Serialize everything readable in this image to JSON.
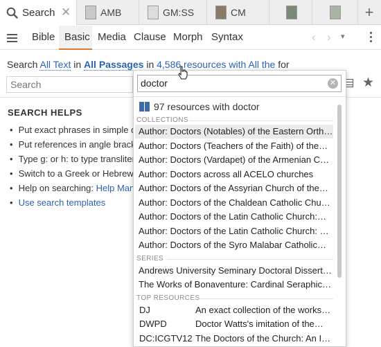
{
  "tabs": [
    {
      "label": "Search",
      "active": true
    },
    {
      "label": "AMB"
    },
    {
      "label": "GM:SS"
    },
    {
      "label": "CM"
    },
    {
      "label": ""
    },
    {
      "label": ""
    }
  ],
  "toolbar": {
    "tabs": [
      "Bible",
      "Basic",
      "Media",
      "Clause",
      "Morph",
      "Syntax"
    ],
    "active_tab": "Basic"
  },
  "sentence": {
    "prefix": "Search",
    "all_text": "All Text",
    "in1": "in",
    "all_passages": "All Passages",
    "in2": "in",
    "resources": "4,586 resources with All the",
    "for": "for"
  },
  "search": {
    "placeholder": "Search"
  },
  "helps": {
    "title": "SEARCH HELPS",
    "items": [
      "Put exact phrases in simple qu",
      "Put references in angle bracket",
      "Type g: or h: to type translitera",
      "Switch to a Greek or Hebrew ke",
      "Help on searching:",
      "Use search templates"
    ],
    "help_link": "Help Manua"
  },
  "dropdown": {
    "query": "doctor",
    "count": "97 resources with doctor",
    "collections_label": "COLLECTIONS",
    "collections": [
      "Author: Doctors (Notables) of the Eastern Orth…",
      "Author: Doctors (Teachers of the Faith) of the…",
      "Author: Doctors (Vardapet) of the Armenian C…",
      "Author: Doctors across all ACELO churches",
      "Author: Doctors of the Assyrian Church of the…",
      "Author: Doctors of the Chaldean Catholic Chur…",
      "Author: Doctors of the Latin Catholic Church:…",
      "Author: Doctors of the Latin Catholic Church: s…",
      "Author: Doctors of the Syro Malabar Catholic…"
    ],
    "series_label": "SERIES",
    "series": [
      "Andrews University Seminary Doctoral Dissert…",
      "The Works of Bonaventure: Cardinal Seraphic…"
    ],
    "top_label": "TOP RESOURCES",
    "top_resources": [
      {
        "abbr": "DJ",
        "title": "An exact collection of the works…"
      },
      {
        "abbr": "DWPD",
        "title": "Doctor Watts's imitation of the…"
      },
      {
        "abbr": "DC:ICGTV12",
        "title": "The Doctors of the Church: An I…"
      }
    ]
  },
  "colors": {
    "accent": "#e07a2e",
    "link": "#2b63b3"
  }
}
